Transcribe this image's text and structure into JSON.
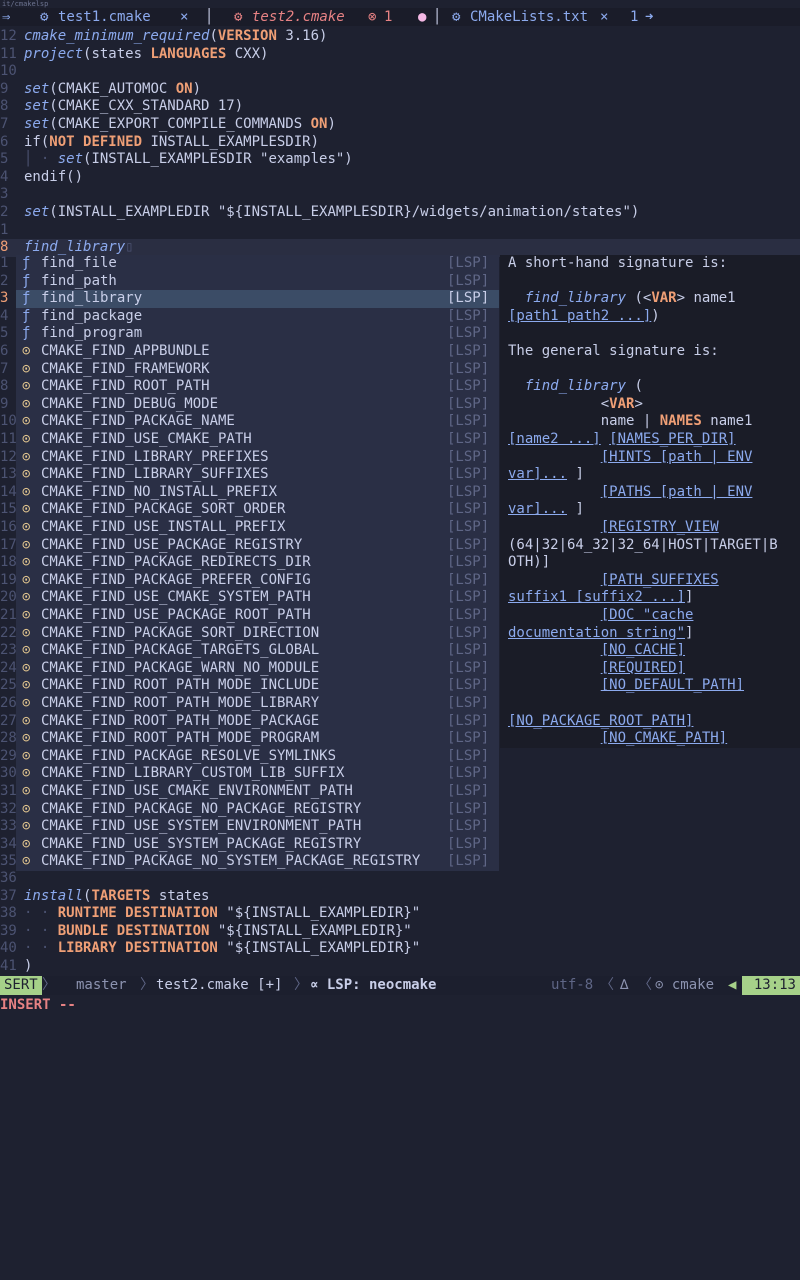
{
  "path": "it/cmakelsp",
  "tabs": [
    {
      "label": "test1.cmake",
      "close": "×",
      "modified": false
    },
    {
      "label": "test2.cmake",
      "errors": "1",
      "modified": true
    },
    {
      "label": "CMakeLists.txt",
      "close": "×",
      "count": "1"
    }
  ],
  "code_top": [
    {
      "ln": "12",
      "parts": [
        {
          "t": "cmake_minimum_required",
          "c": "kw"
        },
        {
          "t": "(",
          "c": ""
        },
        {
          "t": "VERSION",
          "c": "arg"
        },
        {
          "t": " 3.16)",
          "c": ""
        }
      ]
    },
    {
      "ln": "11",
      "parts": [
        {
          "t": "project",
          "c": "kw"
        },
        {
          "t": "(states ",
          "c": ""
        },
        {
          "t": "LANGUAGES",
          "c": "arg"
        },
        {
          "t": " CXX)",
          "c": ""
        }
      ]
    },
    {
      "ln": "10",
      "parts": []
    },
    {
      "ln": "9",
      "parts": [
        {
          "t": "set",
          "c": "kw"
        },
        {
          "t": "(CMAKE_AUTOMOC ",
          "c": ""
        },
        {
          "t": "ON",
          "c": "arg"
        },
        {
          "t": ")",
          "c": ""
        }
      ]
    },
    {
      "ln": "8",
      "parts": [
        {
          "t": "set",
          "c": "kw"
        },
        {
          "t": "(CMAKE_CXX_STANDARD 17)",
          "c": ""
        }
      ]
    },
    {
      "ln": "7",
      "parts": [
        {
          "t": "set",
          "c": "kw"
        },
        {
          "t": "(CMAKE_EXPORT_COMPILE_COMMANDS ",
          "c": ""
        },
        {
          "t": "ON",
          "c": "arg"
        },
        {
          "t": ")",
          "c": ""
        }
      ]
    },
    {
      "ln": "6",
      "parts": [
        {
          "t": "if(",
          "c": ""
        },
        {
          "t": "NOT DEFINED",
          "c": "arg"
        },
        {
          "t": " INSTALL_EXAMPLESDIR)",
          "c": ""
        }
      ]
    },
    {
      "ln": "5",
      "parts": [
        {
          "t": "│ · ",
          "c": "dim"
        },
        {
          "t": "set",
          "c": "kw"
        },
        {
          "t": "(INSTALL_EXAMPLESDIR \"examples\")",
          "c": ""
        }
      ]
    },
    {
      "ln": "4",
      "parts": [
        {
          "t": "endif()",
          "c": ""
        }
      ]
    },
    {
      "ln": "3",
      "parts": []
    },
    {
      "ln": "2",
      "parts": [
        {
          "t": "set",
          "c": "kw"
        },
        {
          "t": "(INSTALL_EXAMPLEDIR \"${INSTALL_EXAMPLESDIR}",
          "c": ""
        },
        {
          "t": "/widgets/animation/states\")",
          "c": ""
        }
      ]
    },
    {
      "ln": "1",
      "parts": []
    },
    {
      "ln": "8",
      "parts": [
        {
          "t": "find_library",
          "c": "kw"
        },
        {
          "t": "▯",
          "c": "dim"
        }
      ],
      "current": true
    }
  ],
  "completion": [
    {
      "ln": "1",
      "icon": "ƒ",
      "label": "find_file",
      "src": "[LSP]"
    },
    {
      "ln": "2",
      "icon": "ƒ",
      "label": "find_path",
      "src": "[LSP]"
    },
    {
      "ln": "3",
      "icon": "ƒ",
      "label": "find_library",
      "src": "[LSP]",
      "selected": true
    },
    {
      "ln": "4",
      "icon": "ƒ",
      "label": "find_package",
      "src": "[LSP]"
    },
    {
      "ln": "5",
      "icon": "ƒ",
      "label": "find_program",
      "src": "[LSP]"
    },
    {
      "ln": "6",
      "icon": "⊙",
      "label": "CMAKE_FIND_APPBUNDLE",
      "src": "[LSP]"
    },
    {
      "ln": "7",
      "icon": "⊙",
      "label": "CMAKE_FIND_FRAMEWORK",
      "src": "[LSP]"
    },
    {
      "ln": "8",
      "icon": "⊙",
      "label": "CMAKE_FIND_ROOT_PATH",
      "src": "[LSP]"
    },
    {
      "ln": "9",
      "icon": "⊙",
      "label": "CMAKE_FIND_DEBUG_MODE",
      "src": "[LSP]"
    },
    {
      "ln": "10",
      "icon": "⊙",
      "label": "CMAKE_FIND_PACKAGE_NAME",
      "src": "[LSP]"
    },
    {
      "ln": "11",
      "icon": "⊙",
      "label": "CMAKE_FIND_USE_CMAKE_PATH",
      "src": "[LSP]"
    },
    {
      "ln": "12",
      "icon": "⊙",
      "label": "CMAKE_FIND_LIBRARY_PREFIXES",
      "src": "[LSP]"
    },
    {
      "ln": "13",
      "icon": "⊙",
      "label": "CMAKE_FIND_LIBRARY_SUFFIXES",
      "src": "[LSP]"
    },
    {
      "ln": "14",
      "icon": "⊙",
      "label": "CMAKE_FIND_NO_INSTALL_PREFIX",
      "src": "[LSP]"
    },
    {
      "ln": "15",
      "icon": "⊙",
      "label": "CMAKE_FIND_PACKAGE_SORT_ORDER",
      "src": "[LSP]"
    },
    {
      "ln": "16",
      "icon": "⊙",
      "label": "CMAKE_FIND_USE_INSTALL_PREFIX",
      "src": "[LSP]"
    },
    {
      "ln": "17",
      "icon": "⊙",
      "label": "CMAKE_FIND_USE_PACKAGE_REGISTRY",
      "src": "[LSP]"
    },
    {
      "ln": "18",
      "icon": "⊙",
      "label": "CMAKE_FIND_PACKAGE_REDIRECTS_DIR",
      "src": "[LSP]"
    },
    {
      "ln": "19",
      "icon": "⊙",
      "label": "CMAKE_FIND_PACKAGE_PREFER_CONFIG",
      "src": "[LSP]"
    },
    {
      "ln": "20",
      "icon": "⊙",
      "label": "CMAKE_FIND_USE_CMAKE_SYSTEM_PATH",
      "src": "[LSP]"
    },
    {
      "ln": "21",
      "icon": "⊙",
      "label": "CMAKE_FIND_USE_PACKAGE_ROOT_PATH",
      "src": "[LSP]"
    },
    {
      "ln": "22",
      "icon": "⊙",
      "label": "CMAKE_FIND_PACKAGE_SORT_DIRECTION",
      "src": "[LSP]"
    },
    {
      "ln": "23",
      "icon": "⊙",
      "label": "CMAKE_FIND_PACKAGE_TARGETS_GLOBAL",
      "src": "[LSP]"
    },
    {
      "ln": "24",
      "icon": "⊙",
      "label": "CMAKE_FIND_PACKAGE_WARN_NO_MODULE",
      "src": "[LSP]"
    },
    {
      "ln": "25",
      "icon": "⊙",
      "label": "CMAKE_FIND_ROOT_PATH_MODE_INCLUDE",
      "src": "[LSP]"
    },
    {
      "ln": "26",
      "icon": "⊙",
      "label": "CMAKE_FIND_ROOT_PATH_MODE_LIBRARY",
      "src": "[LSP]"
    },
    {
      "ln": "27",
      "icon": "⊙",
      "label": "CMAKE_FIND_ROOT_PATH_MODE_PACKAGE",
      "src": "[LSP]"
    },
    {
      "ln": "28",
      "icon": "⊙",
      "label": "CMAKE_FIND_ROOT_PATH_MODE_PROGRAM",
      "src": "[LSP]"
    },
    {
      "ln": "29",
      "icon": "⊙",
      "label": "CMAKE_FIND_PACKAGE_RESOLVE_SYMLINKS",
      "src": "[LSP]"
    },
    {
      "ln": "30",
      "icon": "⊙",
      "label": "CMAKE_FIND_LIBRARY_CUSTOM_LIB_SUFFIX",
      "src": "[LSP]"
    },
    {
      "ln": "31",
      "icon": "⊙",
      "label": "CMAKE_FIND_USE_CMAKE_ENVIRONMENT_PATH",
      "src": "[LSP]"
    },
    {
      "ln": "32",
      "icon": "⊙",
      "label": "CMAKE_FIND_PACKAGE_NO_PACKAGE_REGISTRY",
      "src": "[LSP]"
    },
    {
      "ln": "33",
      "icon": "⊙",
      "label": "CMAKE_FIND_USE_SYSTEM_ENVIRONMENT_PATH",
      "src": "[LSP]"
    },
    {
      "ln": "34",
      "icon": "⊙",
      "label": "CMAKE_FIND_USE_SYSTEM_PACKAGE_REGISTRY",
      "src": "[LSP]"
    },
    {
      "ln": "35",
      "icon": "⊙",
      "label": "CMAKE_FIND_PACKAGE_NO_SYSTEM_PACKAGE_REGISTRY",
      "src": "[LSP]"
    }
  ],
  "doc": [
    [
      {
        "t": "A short-hand signature is:",
        "c": ""
      }
    ],
    [],
    [
      {
        "t": "  ",
        "c": ""
      },
      {
        "t": "find_library",
        "c": "dfn"
      },
      {
        "t": " (<",
        "c": ""
      },
      {
        "t": "VAR",
        "c": "dvar"
      },
      {
        "t": "> name1",
        "c": ""
      }
    ],
    [
      {
        "t": "[path1 path2 ...]",
        "c": "dlink"
      },
      {
        "t": ")",
        "c": ""
      }
    ],
    [],
    [
      {
        "t": "The general signature is:",
        "c": ""
      }
    ],
    [],
    [
      {
        "t": "  ",
        "c": ""
      },
      {
        "t": "find_library",
        "c": "dfn"
      },
      {
        "t": " (",
        "c": ""
      }
    ],
    [
      {
        "t": "           <",
        "c": ""
      },
      {
        "t": "VAR",
        "c": "dvar"
      },
      {
        "t": ">",
        "c": ""
      }
    ],
    [
      {
        "t": "           name | ",
        "c": ""
      },
      {
        "t": "NAMES",
        "c": "dvar"
      },
      {
        "t": " name1",
        "c": ""
      }
    ],
    [
      {
        "t": "[name2 ...]",
        "c": "dlink"
      },
      {
        "t": " ",
        "c": ""
      },
      {
        "t": "[NAMES_PER_DIR]",
        "c": "dlink"
      }
    ],
    [
      {
        "t": "           ",
        "c": ""
      },
      {
        "t": "[HINTS [path | ENV",
        "c": "dlink"
      }
    ],
    [
      {
        "t": "var]...",
        "c": "dlink"
      },
      {
        "t": " ]",
        "c": ""
      }
    ],
    [
      {
        "t": "           ",
        "c": ""
      },
      {
        "t": "[PATHS [path | ENV",
        "c": "dlink"
      }
    ],
    [
      {
        "t": "var]...",
        "c": "dlink"
      },
      {
        "t": " ]",
        "c": ""
      }
    ],
    [
      {
        "t": "           ",
        "c": ""
      },
      {
        "t": "[REGISTRY_VIEW",
        "c": "dlink"
      }
    ],
    [
      {
        "t": "(64|32|64_32|32_64|HOST|TARGET|B",
        "c": ""
      }
    ],
    [
      {
        "t": "OTH)]",
        "c": ""
      }
    ],
    [
      {
        "t": "           ",
        "c": ""
      },
      {
        "t": "[PATH_SUFFIXES",
        "c": "dlink"
      }
    ],
    [
      {
        "t": "suffix1 [suffix2 ...]",
        "c": "dlink"
      },
      {
        "t": "]",
        "c": ""
      }
    ],
    [
      {
        "t": "           ",
        "c": ""
      },
      {
        "t": "[DOC \"cache",
        "c": "dlink"
      }
    ],
    [
      {
        "t": "documentation string\"",
        "c": "dlink"
      },
      {
        "t": "]",
        "c": ""
      }
    ],
    [
      {
        "t": "           ",
        "c": ""
      },
      {
        "t": "[NO_CACHE]",
        "c": "dlink"
      }
    ],
    [
      {
        "t": "           ",
        "c": ""
      },
      {
        "t": "[REQUIRED]",
        "c": "dlink"
      }
    ],
    [
      {
        "t": "           ",
        "c": ""
      },
      {
        "t": "[NO_DEFAULT_PATH]",
        "c": "dlink"
      }
    ],
    [],
    [
      {
        "t": "[NO_PACKAGE_ROOT_PATH]",
        "c": "dlink"
      }
    ],
    [
      {
        "t": "           ",
        "c": ""
      },
      {
        "t": "[NO_CMAKE_PATH]",
        "c": "dlink"
      }
    ]
  ],
  "code_bottom": [
    {
      "ln": "36",
      "parts": []
    },
    {
      "ln": "37",
      "parts": [
        {
          "t": "install",
          "c": "kw"
        },
        {
          "t": "(",
          "c": ""
        },
        {
          "t": "TARGETS",
          "c": "arg"
        },
        {
          "t": " states",
          "c": ""
        }
      ]
    },
    {
      "ln": "38",
      "parts": [
        {
          "t": "· · ",
          "c": "dim"
        },
        {
          "t": "RUNTIME DESTINATION",
          "c": "arg"
        },
        {
          "t": " \"${INSTALL_EXAMPLEDIR}\"",
          "c": ""
        }
      ]
    },
    {
      "ln": "39",
      "parts": [
        {
          "t": "· · ",
          "c": "dim"
        },
        {
          "t": "BUNDLE DESTINATION",
          "c": "arg"
        },
        {
          "t": " \"${INSTALL_EXAMPLEDIR}\"",
          "c": ""
        }
      ]
    },
    {
      "ln": "40",
      "parts": [
        {
          "t": "· · ",
          "c": "dim"
        },
        {
          "t": "LIBRARY DESTINATION",
          "c": "arg"
        },
        {
          "t": " \"${INSTALL_EXAMPLEDIR}\"",
          "c": ""
        }
      ]
    },
    {
      "ln": "41",
      "parts": [
        {
          "t": ")",
          "c": ""
        }
      ]
    }
  ],
  "status": {
    "mode": "SERT",
    "branch_icon": "",
    "branch": "master",
    "file": "test2.cmake [+]",
    "lsp": "∝ LSP: neocmake",
    "encoding": "utf-8",
    "format_icon": "∆",
    "filetype": "⊙ cmake",
    "position": "13:13"
  },
  "cmdline": "INSERT --",
  "colors": {
    "accent": "#a6d189",
    "keyword": "#8caaee",
    "argument": "#ef9f76",
    "error": "#e78284"
  }
}
